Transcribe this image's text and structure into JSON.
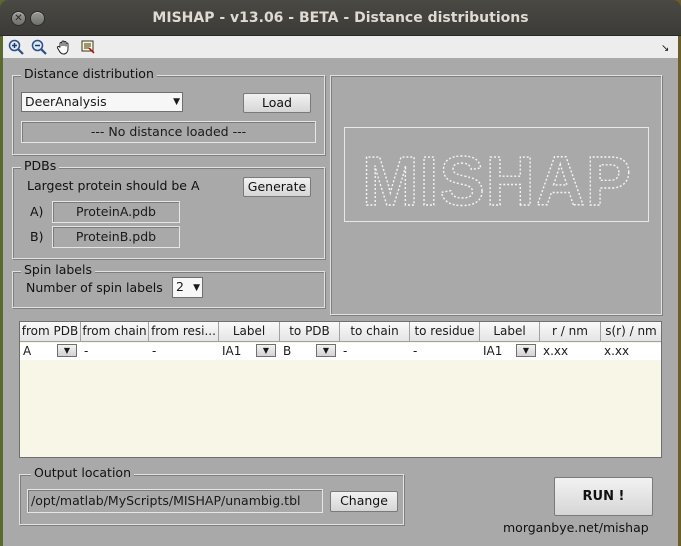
{
  "window": {
    "title": "MISHAP - v13.06 - BETA - Distance distributions"
  },
  "toolbar": {
    "icons": [
      "zoom-in-icon",
      "zoom-out-icon",
      "pan-hand-icon",
      "data-cursor-icon"
    ],
    "corner_glyph": "↘"
  },
  "distance": {
    "legend": "Distance distribution",
    "method": "DeerAnalysis",
    "load_label": "Load",
    "status": "--- No distance loaded ---"
  },
  "pdbs": {
    "legend": "PDBs",
    "hint": "Largest protein should be A",
    "generate_label": "Generate",
    "a_label": "A)",
    "a_file": "ProteinA.pdb",
    "b_label": "B)",
    "b_file": "ProteinB.pdb"
  },
  "spin": {
    "legend": "Spin labels",
    "count_label": "Number of spin labels",
    "count": "2"
  },
  "logo": {
    "text": "MISHAP"
  },
  "table": {
    "columns": [
      "from PDB",
      "from chain",
      "from resi...",
      "Label",
      "to PDB",
      "to chain",
      "to residue",
      "Label",
      "r / nm",
      "s(r) / nm"
    ],
    "rows": [
      [
        "A",
        "-",
        "-",
        "IA1",
        "B",
        "-",
        "-",
        "IA1",
        "x.xx",
        "x.xx"
      ]
    ]
  },
  "output": {
    "legend": "Output location",
    "path": "/opt/matlab/MyScripts/MISHAP/unambig.tbl",
    "change_label": "Change"
  },
  "run_label": "RUN !",
  "footer_link": "morganbye.net/mishap",
  "colors": {
    "window_bg": "#a9a9a9",
    "titlebar": "#3c3b37",
    "table_bg": "#f8f7e7"
  }
}
